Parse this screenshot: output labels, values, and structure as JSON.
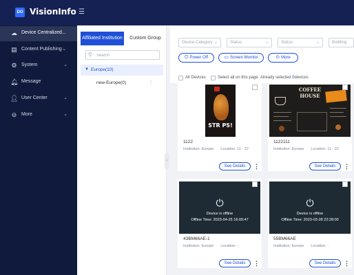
{
  "app": {
    "brand": "VisionInfo",
    "logo_text": "DO"
  },
  "sidebar": {
    "items": [
      {
        "label": "Device Centralized...",
        "icon": "cloud-icon",
        "glyph": "☁",
        "expandable": false,
        "active": true
      },
      {
        "label": "Content Publishing",
        "icon": "content-icon",
        "glyph": "▤",
        "expandable": true,
        "active": false
      },
      {
        "label": "System",
        "icon": "gear-icon",
        "glyph": "⚙",
        "expandable": true,
        "active": false
      },
      {
        "label": "Message",
        "icon": "bell-icon",
        "glyph": "🔔︎",
        "expandable": false,
        "active": false
      },
      {
        "label": "User Center",
        "icon": "user-icon",
        "glyph": "👤︎",
        "expandable": true,
        "active": false
      },
      {
        "label": "More",
        "icon": "more-circle-icon",
        "glyph": "⊖",
        "expandable": true,
        "active": false
      }
    ]
  },
  "groups": {
    "tabs": [
      "Affiliated Institution",
      "Custom Group"
    ],
    "search_placeholder": "Search",
    "tree_root": "Europe(10)",
    "tree_child": "new-Europe(0)"
  },
  "filters": {
    "selects": [
      "Device Category",
      "Status",
      "Status",
      "Building"
    ],
    "actions": [
      {
        "label": "Power Off",
        "icon": "power-icon",
        "glyph": "⏻"
      },
      {
        "label": "Screen Monitor",
        "icon": "monitor-icon",
        "glyph": "▭"
      },
      {
        "label": "More",
        "icon": "more-icon",
        "glyph": "⊙"
      }
    ]
  },
  "selection": {
    "all_devices": "All Devices",
    "select_page": "Select all on this page",
    "already_selected": "Already selected",
    "selected_count": "0",
    "devices_suffix": "devices"
  },
  "cards": [
    {
      "name": "1122",
      "institution": "Institution: Europe",
      "location": "Location: 11 - 22",
      "details": "See Details",
      "screen": "poster",
      "poster_text": "STR PS!"
    },
    {
      "name": "1122111",
      "institution": "Institution: Europe",
      "location": "Location: 11 - 22",
      "details": "See Details",
      "screen": "coffee",
      "board_text": "COFFEE HOUSE"
    },
    {
      "name": "43BM66AE-1",
      "institution": "Institution: Europe",
      "location": "Location: -",
      "details": "See Details",
      "screen": "offline",
      "offline_text": "Device is offline",
      "offline_time": "Offline Time: 2023-04-25 16:09:47"
    },
    {
      "name": "55BM66AE",
      "institution": "Institution: Europe",
      "location": "Location: -",
      "details": "See Details",
      "screen": "offline",
      "offline_text": "Device is offline",
      "offline_time": "Offline Time: 2023-03-28 22:28:00"
    }
  ],
  "colors": {
    "accent": "#1f4fd6",
    "sidebar_bg": "#101a3c",
    "topbar_bg": "#152152"
  }
}
